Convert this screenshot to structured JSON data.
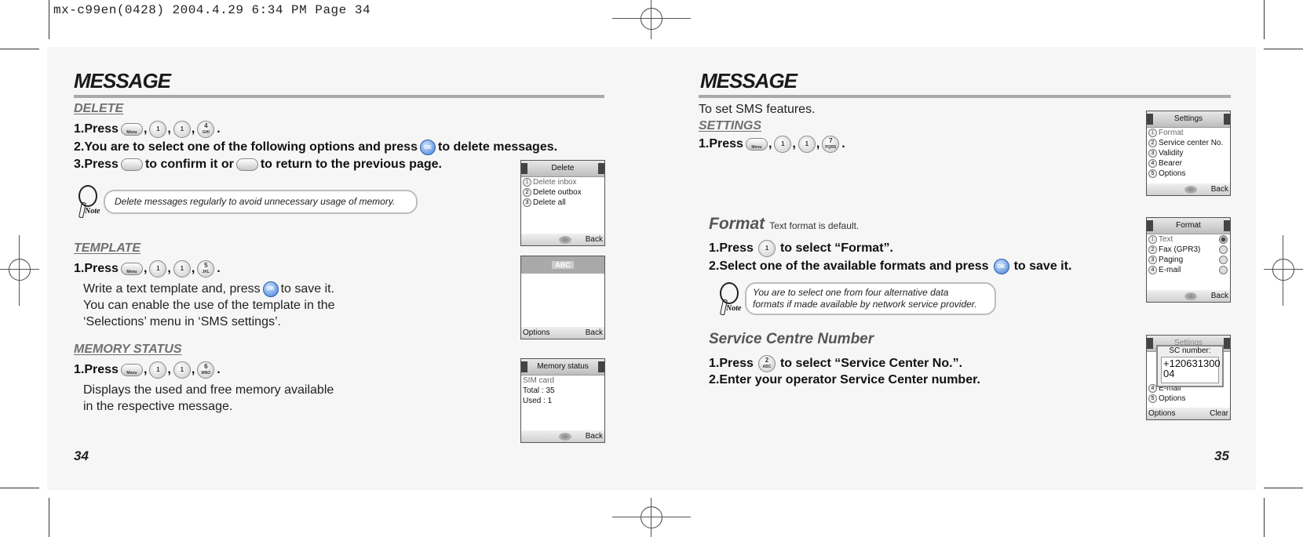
{
  "slug": "mx-c99en(0428)  2004.4.29  6:34 PM  Page 34",
  "left_page": {
    "title": "MESSAGE",
    "page_number": "34",
    "delete": {
      "heading": "DELETE",
      "step1_prefix": "1.Press",
      "step1_keys": [
        "Menu",
        "1",
        "1",
        "4 GHI"
      ],
      "step2_a": "2.You are to select one of the following options and press",
      "step2_b": "to delete messages.",
      "step3_a": "3.Press",
      "step3_b": "to confirm it or",
      "step3_c": "to return to the previous page.",
      "note": "Delete messages regularly to avoid unnecessary usage of memory.",
      "screen": {
        "title": "Delete",
        "items": [
          "Delete inbox",
          "Delete outbox",
          "Delete all"
        ],
        "right_soft": "Back"
      }
    },
    "template": {
      "heading": "TEMPLATE",
      "step1_prefix": "1.Press",
      "step1_keys": [
        "Menu",
        "1",
        "1",
        "5 JKL"
      ],
      "line1_a": "Write a text template and, press",
      "line1_b": "to save it.",
      "line2": "You can enable the use of the template in the",
      "line3": "‘Selections’ menu in ‘SMS settings’.",
      "screen": {
        "mode": "ABC",
        "left_soft": "Options",
        "right_soft": "Back"
      }
    },
    "memory": {
      "heading": "MEMORY STATUS",
      "step1_prefix": "1.Press",
      "step1_keys": [
        "Menu",
        "1",
        "1",
        "6 MNO"
      ],
      "line1": "Displays the used and free memory available",
      "line2": "in the respective message.",
      "screen": {
        "title": "Memory status",
        "lines": [
          "SIM card",
          "Total : 35",
          "Used : 1"
        ],
        "right_soft": "Back"
      }
    }
  },
  "right_page": {
    "title": "MESSAGE",
    "page_number": "35",
    "intro": "To set SMS features.",
    "settings": {
      "heading": "SETTINGS",
      "step1_prefix": "1.Press",
      "step1_keys": [
        "Menu",
        "1",
        "1",
        "7 PQRS"
      ],
      "screen": {
        "title": "Settings",
        "items": [
          "Format",
          "Service center No.",
          "Validity",
          "Bearer",
          "Options"
        ],
        "right_soft": "Back"
      }
    },
    "format": {
      "heading": "Format",
      "subtitle": "Text format is default.",
      "step1_a": "1.Press",
      "step1_b": "to select “Format”.",
      "step2_a": "2.Select one of the available formats and press",
      "step2_b": "to save it.",
      "note_line1": "You are to select one from four alternative data",
      "note_line2": "formats if made available by network service provider.",
      "screen": {
        "title": "Format",
        "items": [
          "Text",
          "Fax (GPR3)",
          "Paging",
          "E-mail"
        ],
        "selected_index": 0,
        "right_soft": "Back"
      }
    },
    "service_centre": {
      "heading": "Service Centre Number",
      "step1_a": "1.Press",
      "step1_b": "to select “Service Center No.”.",
      "step2": "2.Enter your operator Service Center number.",
      "screen": {
        "title": "Settings",
        "popup_label": "SC number:",
        "popup_value": "+120631300\n04",
        "visible_items": [
          "E-mail",
          "Options"
        ],
        "left_soft": "Options",
        "right_soft": "Clear"
      }
    }
  },
  "keys": {
    "menu": "Menu",
    "ok": "OK",
    "one": "1",
    "two": "2"
  }
}
